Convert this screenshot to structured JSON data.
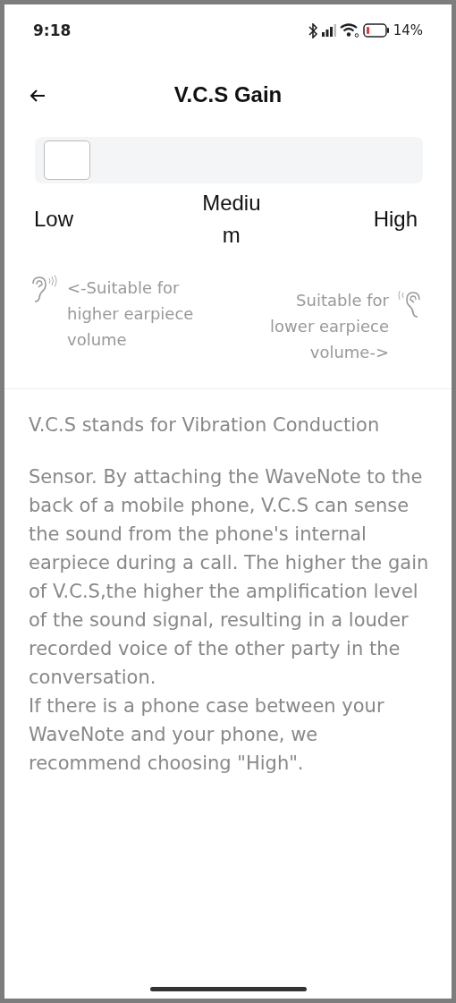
{
  "status_bar": {
    "time": "9:18",
    "battery": "14%"
  },
  "header": {
    "title": "V.C.S Gain"
  },
  "gain_slider": {
    "level": 0,
    "options": [
      "Low",
      "Medium",
      "High"
    ]
  },
  "hints": [
    {
      "kind": "left",
      "text": "<-Suitable for higher earpiece volume"
    },
    {
      "kind": "right",
      "text": "Suitable for lower earpiece volume->"
    }
  ],
  "description": [
    "V.C.S stands for Vibration Conduction",
    "Sensor. By attaching the WaveNote to the back of a mobile phone, V.C.S can sense the sound from the phone's internal earpiece during a call. The higher the gain of V.C.S,the higher the amplification level of the sound signal, resulting in a louder recorded voice of the other party in the conversation.",
    "If there is a phone case between your WaveNote and your phone, we recommend choosing \"High\"."
  ]
}
